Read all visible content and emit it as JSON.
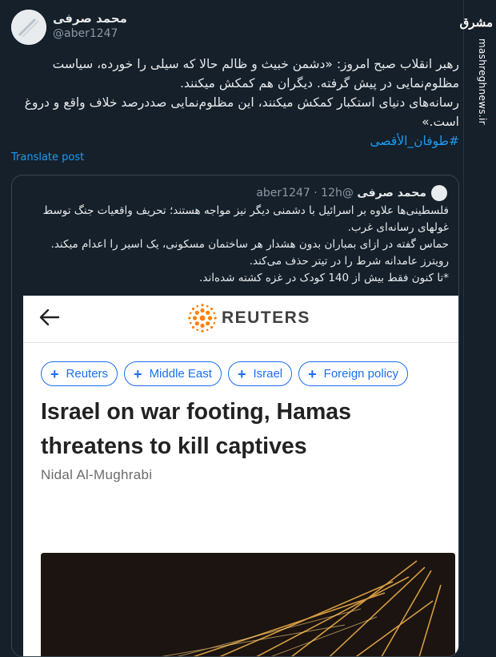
{
  "watermark": {
    "logo_text": "مشرق",
    "url": "mashreghnews.ir"
  },
  "post": {
    "author_name": "محمد صرفی",
    "handle": "@aber1247",
    "text_lines": [
      "رهبر انقلاب صبح امروز: «دشمن خبیث و ظالم حالا که سیلی را خورده، سیاست مظلوم‌نمایی در پیش گرفته. دیگران هم کمکش میکنند.",
      "رسانه‌های دنیای استکبار کمکش میکنند، این مظلوم‌نمایی صددرصد خلاف واقع و دروغ است.»"
    ],
    "hashtag": "#طوفان_الأقصى",
    "translate_label": "Translate post"
  },
  "quote": {
    "author_name": "محمد صرفی",
    "handle": "@aber1247",
    "separator": "·",
    "time": "12h",
    "text_lines": [
      "فلسطینی‌ها علاوه بر اسرائیل با دشمنی دیگر نیز مواجه هستند؛ تحریف واقعیات جنگ توسط غولهای رسانه‌ای غرب.",
      "حماس گفته در ازای بمباران بدون هشدار هر ساختمان مسکونی، یک اسیر را اعدام میکند.",
      "رویترز عامدانه شرط را در تیتر حذف می‌کند.",
      "*تا کنون فقط بیش از 140 کودک در غزه کشته شده‌اند."
    ]
  },
  "article": {
    "brand": "REUTERS",
    "tags": [
      "Reuters",
      "Middle East",
      "Israel",
      "Foreign policy"
    ],
    "headline": "Israel on war footing, Hamas threatens to kill captives",
    "byline": "Nidal Al-Mughrabi"
  },
  "colors": {
    "background": "#15202b",
    "link": "#1d9bf0",
    "reuters_orange": "#ff8000",
    "chip_blue": "#1b6ef3"
  }
}
